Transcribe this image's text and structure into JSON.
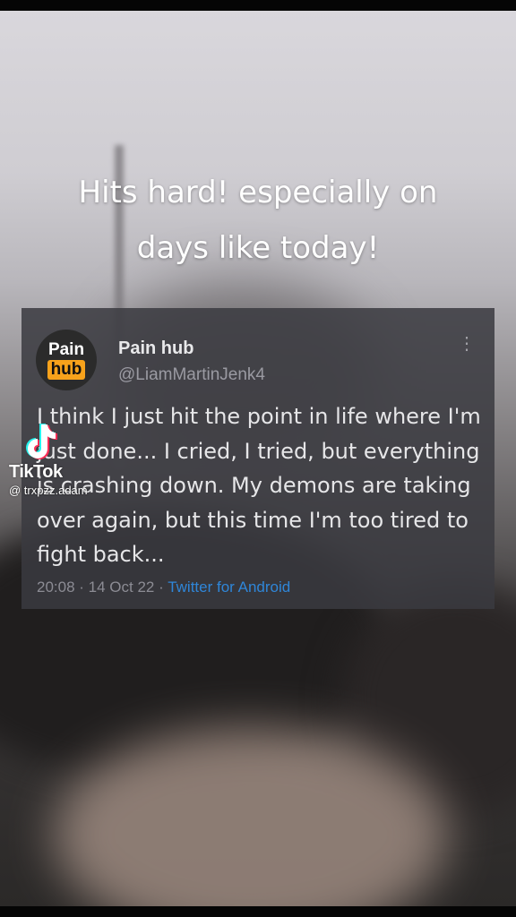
{
  "caption": {
    "line1": "Hits hard! especially on",
    "line2": "days like today!"
  },
  "tweet": {
    "avatar_logo": {
      "top": "Pain",
      "bottom": "hub"
    },
    "display_name": "Pain hub",
    "handle": "@LiamMartinJenk4",
    "more_icon": "⋮",
    "body": "I think I just hit the point in life where I'm just done... I cried, I tried, but everything is crashing down. My demons are taking over again, but this time I'm too tired to fight back...",
    "time": "20:08",
    "date": "14 Oct 22",
    "source": "Twitter for Android"
  },
  "watermark": {
    "brand": "TikTok",
    "username": "@ trxpzz.adam",
    "icon": "tiktok-note-icon"
  },
  "colors": {
    "caption_text": "#ffffff",
    "tweet_card": "#3a3a40",
    "source_link": "#2f86d8",
    "logo_accent": "#f7a21b"
  }
}
